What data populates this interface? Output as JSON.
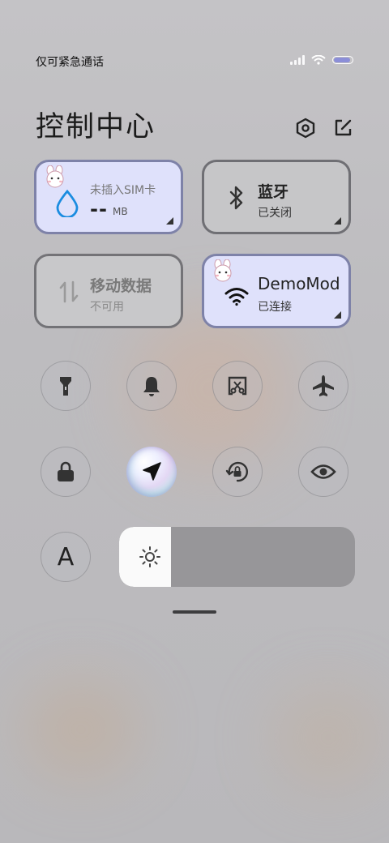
{
  "status_bar": {
    "carrier_text": "仅可紧急通话",
    "battery_percent": 90
  },
  "header": {
    "title": "控制中心",
    "settings_icon": "settings-hex-icon",
    "edit_icon": "edit-icon"
  },
  "tiles": {
    "data_usage": {
      "label": "未插入SIM卡",
      "value": "--",
      "unit": "MB",
      "icon": "water-drop-icon"
    },
    "bluetooth": {
      "title": "蓝牙",
      "status": "已关闭",
      "icon": "bluetooth-icon"
    },
    "mobile_data": {
      "title": "移动数据",
      "status": "不可用",
      "icon": "data-arrows-icon"
    },
    "wifi": {
      "title": "DemoMod",
      "status": "已连接",
      "icon": "wifi-icon"
    }
  },
  "toggles_row1": [
    "flashlight-icon",
    "bell-icon",
    "screenshot-icon",
    "airplane-icon"
  ],
  "toggles_row2": [
    "lock-icon",
    "location-icon",
    "rotation-lock-icon",
    "eye-icon"
  ],
  "font_button": {
    "label": "A"
  },
  "brightness": {
    "level": 0.22,
    "icon": "sun-icon"
  },
  "colors": {
    "active_tile": "#dfe1fb",
    "inactive_tile": "#c6c6c8",
    "accent_blue": "#1a8ce0"
  }
}
